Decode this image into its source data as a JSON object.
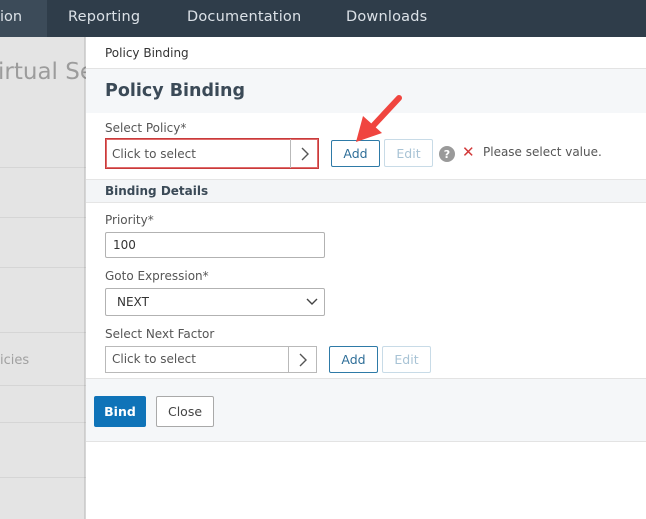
{
  "topnav": {
    "active_partial": "ion",
    "items": [
      "Reporting",
      "Documentation",
      "Downloads"
    ]
  },
  "background": {
    "title_partial": "irtual Se",
    "label_partial": "icies"
  },
  "panel": {
    "breadcrumb": "Policy Binding",
    "title": "Policy Binding",
    "select_policy": {
      "label": "Select Policy*",
      "placeholder": "Click to select",
      "add_label": "Add",
      "edit_label": "Edit",
      "error_text": "Please select value."
    },
    "binding_details": {
      "section_title": "Binding Details",
      "priority_label": "Priority*",
      "priority_value": "100",
      "goto_label": "Goto Expression*",
      "goto_value": "NEXT",
      "next_factor_label": "Select Next Factor",
      "next_factor_placeholder": "Click to select",
      "add_label": "Add",
      "edit_label": "Edit"
    },
    "footer": {
      "bind_label": "Bind",
      "close_label": "Close"
    }
  },
  "colors": {
    "nav_bg": "#2f3d4a",
    "primary": "#0f73b8",
    "error": "#d23a3a",
    "annotation_arrow": "#f0453f"
  }
}
